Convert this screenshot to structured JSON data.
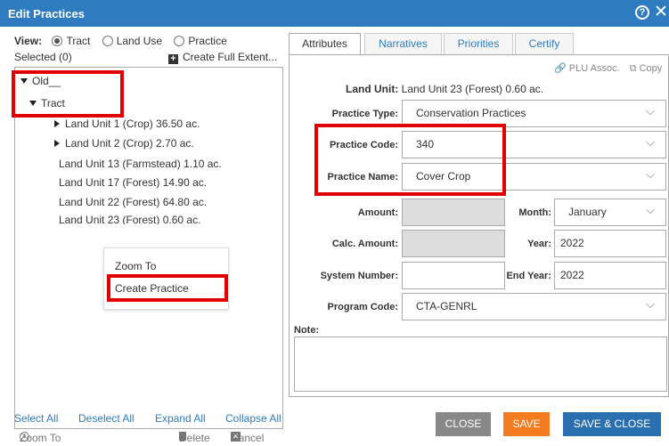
{
  "window": {
    "title": "Edit Practices",
    "help_icon": "help-circle-icon",
    "close_icon": "close-icon"
  },
  "left": {
    "view_label": "View:",
    "view_options": [
      "Tract",
      "Land Use",
      "Practice"
    ],
    "view_selected": "Tract",
    "selected_text": "Selected (0)",
    "create_full_extent": "Create Full Extent...",
    "tree": {
      "root": "Old__",
      "tract": "Tract",
      "units": [
        "Land Unit 1 (Crop) 36.50 ac.",
        "Land Unit 2 (Crop) 2.70 ac.",
        "Land Unit 13 (Farmstead) 1.10 ac.",
        "Land Unit 17 (Forest) 14.90 ac.",
        "Land Unit 22 (Forest) 64.80 ac.",
        "Land Unit 23 (Forest) 0.60 ac."
      ]
    },
    "context_menu": {
      "zoom_to": "Zoom To",
      "create_practice": "Create Practice"
    },
    "links": {
      "select_all": "Select All",
      "deselect_all": "Deselect All",
      "expand_all": "Expand All",
      "collapse_all": "Collapse All"
    },
    "actions": {
      "zoom_to": "Zoom To",
      "delete": "Delete",
      "cancel": "Cancel"
    }
  },
  "tabs": [
    "Attributes",
    "Narratives",
    "Priorities",
    "Certify"
  ],
  "active_tab": "Attributes",
  "attributes": {
    "plu_assoc": "PLU Assoc.",
    "copy": "Copy",
    "land_unit_label": "Land Unit:",
    "land_unit_value": "Land Unit 23 (Forest) 0.60 ac.",
    "practice_type_label": "Practice Type:",
    "practice_type": "Conservation Practices",
    "practice_code_label": "Practice Code:",
    "practice_code": "340",
    "practice_name_label": "Practice Name:",
    "practice_name": "Cover Crop",
    "amount_label": "Amount:",
    "amount": "",
    "month_label": "Month:",
    "month": "January",
    "calc_amount_label": "Calc. Amount:",
    "calc_amount": "",
    "year_label": "Year:",
    "year": "2022",
    "system_number_label": "System Number:",
    "system_number": "",
    "end_year_label": "End Year:",
    "end_year": "2022",
    "program_code_label": "Program Code:",
    "program_code": "CTA-GENRL",
    "note_label": "Note:",
    "note": ""
  },
  "buttons": {
    "close": "CLOSE",
    "save": "SAVE",
    "save_close": "SAVE & CLOSE"
  },
  "colors": {
    "header": "#2f7bbf",
    "highlight": "#e00000",
    "save": "#f47c20",
    "save_close": "#2a6fb0",
    "close_btn": "#888888"
  }
}
